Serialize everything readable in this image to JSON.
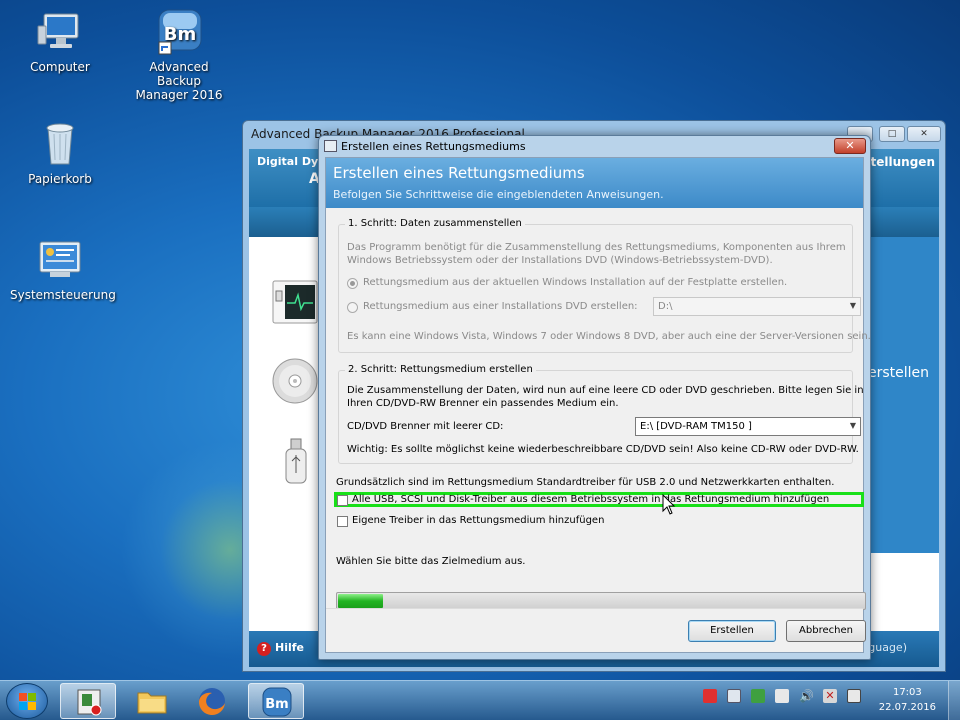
{
  "desktop": {
    "icons": [
      {
        "label": "Computer"
      },
      {
        "label": "Advanced Backup Manager 2016"
      },
      {
        "label": "Papierkorb"
      },
      {
        "label": "Systemsteuerung"
      }
    ]
  },
  "background_window": {
    "title": "Advanced Backup Manager 2016 Professional",
    "header_left_1": "Digital Dyn...",
    "header_left_2": "Ad",
    "header_right": "nstellungen",
    "side_text": "erstellen",
    "help_label": "Hilfe",
    "lang_label": "guage)"
  },
  "dialog": {
    "window_title": "Erstellen eines Rettungsmediums",
    "heading": "Erstellen eines Rettungsmediums",
    "subheading": "Befolgen Sie Schrittweise die eingeblendeten Anweisungen.",
    "step1": {
      "legend": "1. Schritt: Daten zusammenstellen",
      "desc_line1": "Das Programm benötigt für die Zusammenstellung des Rettungsmediums, Komponenten aus Ihrem",
      "desc_line2": "Windows Betriebssystem oder der Installations DVD (Windows-Betriebssystem-DVD).",
      "option1": "Rettungsmedium aus der aktuellen Windows Installation auf der Festplatte erstellen.",
      "option2": "Rettungsmedium aus einer Installations DVD erstellen:",
      "dvd_drive": "D:\\",
      "note": "Es kann eine Windows Vista, Windows 7 oder Windows 8 DVD, aber auch eine der Server-Versionen sein."
    },
    "step2": {
      "legend": "2. Schritt: Rettungsmedium erstellen",
      "desc_line1": "Die Zusammenstellung der Daten, wird nun auf eine leere CD oder DVD geschrieben. Bitte legen Sie in",
      "desc_line2": "Ihren CD/DVD-RW Brenner ein passendes Medium ein.",
      "burner_label": "CD/DVD Brenner mit leerer CD:",
      "burner_value": "E:\\ [DVD-RAM TM150    ]",
      "warning": "Wichtig: Es sollte möglichst keine wiederbeschreibbare CD/DVD sein! Also keine CD-RW oder DVD-RW."
    },
    "info_drivers": "Grundsätzlich sind im Rettungsmedium Standardtreiber für USB 2.0 und Netzwerkkarten enthalten.",
    "checkbox_all_drivers": "Alle USB, SCSI und Disk-Treiber aus diesem Betriebssystem in das Rettungsmedium hinzufügen",
    "checkbox_own_drivers": "Eigene Treiber in das Rettungsmedium hinzufügen",
    "status_text": "Wählen Sie bitte das Zielmedium aus.",
    "progress": 0.085,
    "create_button": "Erstellen",
    "cancel_button": "Abbrechen",
    "close_glyph": "✕"
  },
  "taskbar": {
    "clock_time": "17:03",
    "clock_date": "22.07.2016"
  },
  "colors": {
    "highlight": "#18e018",
    "progress": "#22b422",
    "dialog_header": "#3d8ac8"
  }
}
